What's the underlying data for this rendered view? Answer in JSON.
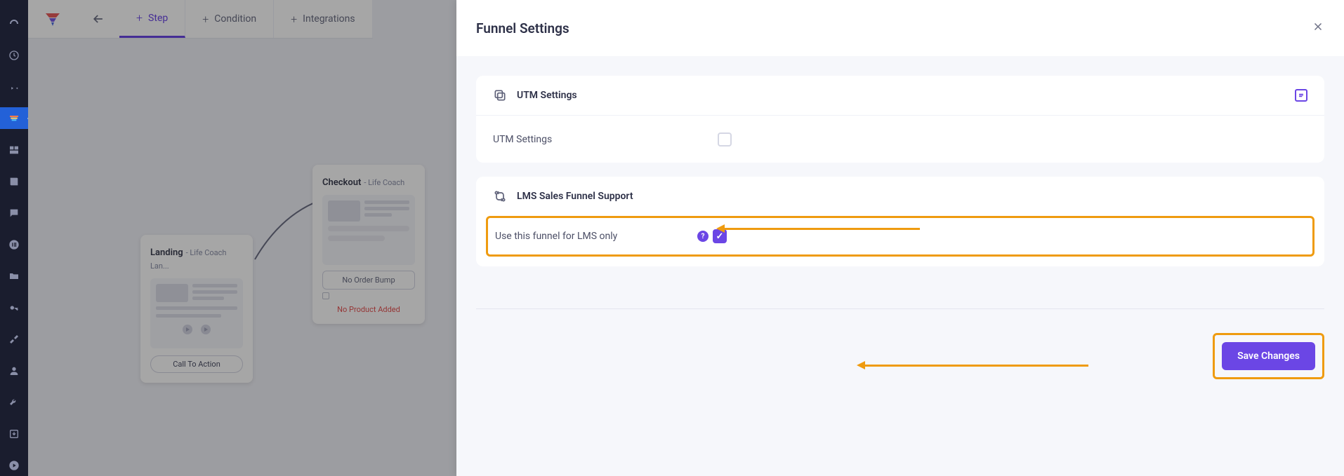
{
  "rail": {
    "items": [
      {
        "name": "dashboard-icon"
      },
      {
        "name": "clock-icon"
      },
      {
        "name": "pin-icon"
      },
      {
        "name": "funnel-bars-icon",
        "active": true
      },
      {
        "name": "layout-icon"
      },
      {
        "name": "book-icon"
      },
      {
        "name": "chat-icon"
      },
      {
        "name": "elementor-icon"
      },
      {
        "name": "folder-icon"
      },
      {
        "name": "key-icon"
      },
      {
        "name": "wrench-diag-icon"
      },
      {
        "name": "user-icon"
      },
      {
        "name": "wrench-icon"
      },
      {
        "name": "download-icon"
      },
      {
        "name": "play-icon"
      }
    ]
  },
  "toolbar": {
    "tabs": [
      {
        "label": "Step",
        "active": true
      },
      {
        "label": "Condition"
      },
      {
        "label": "Integrations"
      }
    ]
  },
  "cards": {
    "landing": {
      "title": "Landing",
      "sub": "- Life Coach Lan...",
      "cta": "Call To Action"
    },
    "checkout": {
      "title": "Checkout",
      "sub": "- Life Coach",
      "orderBump": "No Order Bump",
      "noProduct": "No Product Added"
    }
  },
  "panel": {
    "title": "Funnel Settings",
    "utm": {
      "header": "UTM Settings",
      "rowLabel": "UTM Settings"
    },
    "lms": {
      "header": "LMS Sales Funnel Support",
      "rowLabel": "Use this funnel for LMS only"
    },
    "saveLabel": "Save Changes"
  }
}
